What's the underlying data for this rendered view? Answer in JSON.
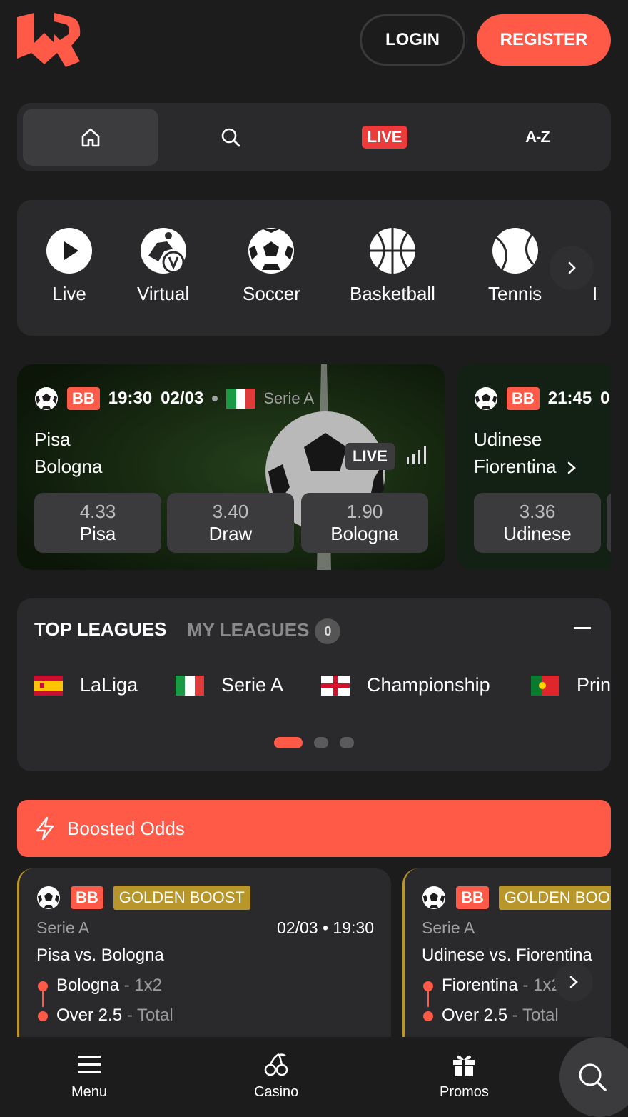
{
  "header": {
    "login_label": "LOGIN",
    "register_label": "REGISTER"
  },
  "tabs": [
    {
      "icon": "home-icon"
    },
    {
      "icon": "search-icon"
    },
    {
      "label": "LIVE"
    },
    {
      "label": "A-Z"
    }
  ],
  "sports": [
    {
      "label": "Live",
      "icon": "play-icon"
    },
    {
      "label": "Virtual",
      "icon": "virtual-soccer-icon"
    },
    {
      "label": "Soccer",
      "icon": "soccer-ball-icon"
    },
    {
      "label": "Basketball",
      "icon": "basketball-icon"
    },
    {
      "label": "Tennis",
      "icon": "tennis-ball-icon"
    },
    {
      "label": "I"
    }
  ],
  "matches": [
    {
      "badge": "BB",
      "time": "19:30",
      "date": "02/03",
      "league": "Serie A",
      "home": "Pisa",
      "away": "Bologna",
      "live_label": "LIVE",
      "odds": [
        {
          "value": "4.33",
          "label": "Pisa"
        },
        {
          "value": "3.40",
          "label": "Draw"
        },
        {
          "value": "1.90",
          "label": "Bologna"
        }
      ]
    },
    {
      "badge": "BB",
      "time": "21:45",
      "date": "0",
      "home": "Udinese",
      "away": "Fiorentina",
      "odds": [
        {
          "value": "3.36",
          "label": "Udinese"
        }
      ]
    }
  ],
  "leagues": {
    "top_label": "TOP LEAGUES",
    "my_label": "MY LEAGUES",
    "my_count": "0",
    "items": [
      {
        "name": "LaLiga",
        "flag": "spain"
      },
      {
        "name": "Serie A",
        "flag": "italy"
      },
      {
        "name": "Championship",
        "flag": "england"
      },
      {
        "name": "Prin",
        "flag": "portugal"
      }
    ]
  },
  "boosted": {
    "title": "Boosted Odds",
    "cards": [
      {
        "badge": "BB",
        "boost_label": "GOLDEN BOOST",
        "league": "Serie A",
        "datetime": "02/03 • 19:30",
        "match": "Pisa vs. Bologna",
        "selections": [
          {
            "pick": "Bologna",
            "sep": " - ",
            "market": "1x2"
          },
          {
            "pick": "Over 2.5",
            "sep": " - ",
            "market": "Total"
          }
        ]
      },
      {
        "badge": "BB",
        "boost_label": "GOLDEN BOOS",
        "league": "Serie A",
        "match": "Udinese vs. Fiorentina",
        "selections": [
          {
            "pick": "Fiorentina",
            "sep": " - ",
            "market": "1x2"
          },
          {
            "pick": "Over 2.5",
            "sep": " - ",
            "market": "Total"
          }
        ]
      }
    ]
  },
  "bottom_nav": [
    {
      "label": "Menu",
      "icon": "menu-icon"
    },
    {
      "label": "Casino",
      "icon": "cherries-icon"
    },
    {
      "label": "Promos",
      "icon": "gift-icon"
    }
  ],
  "colors": {
    "accent": "#ff5a47",
    "gold": "#b9962a",
    "live_red": "#ec3b3b",
    "surface": "#2a2a2c",
    "background": "#1c1c1d"
  }
}
